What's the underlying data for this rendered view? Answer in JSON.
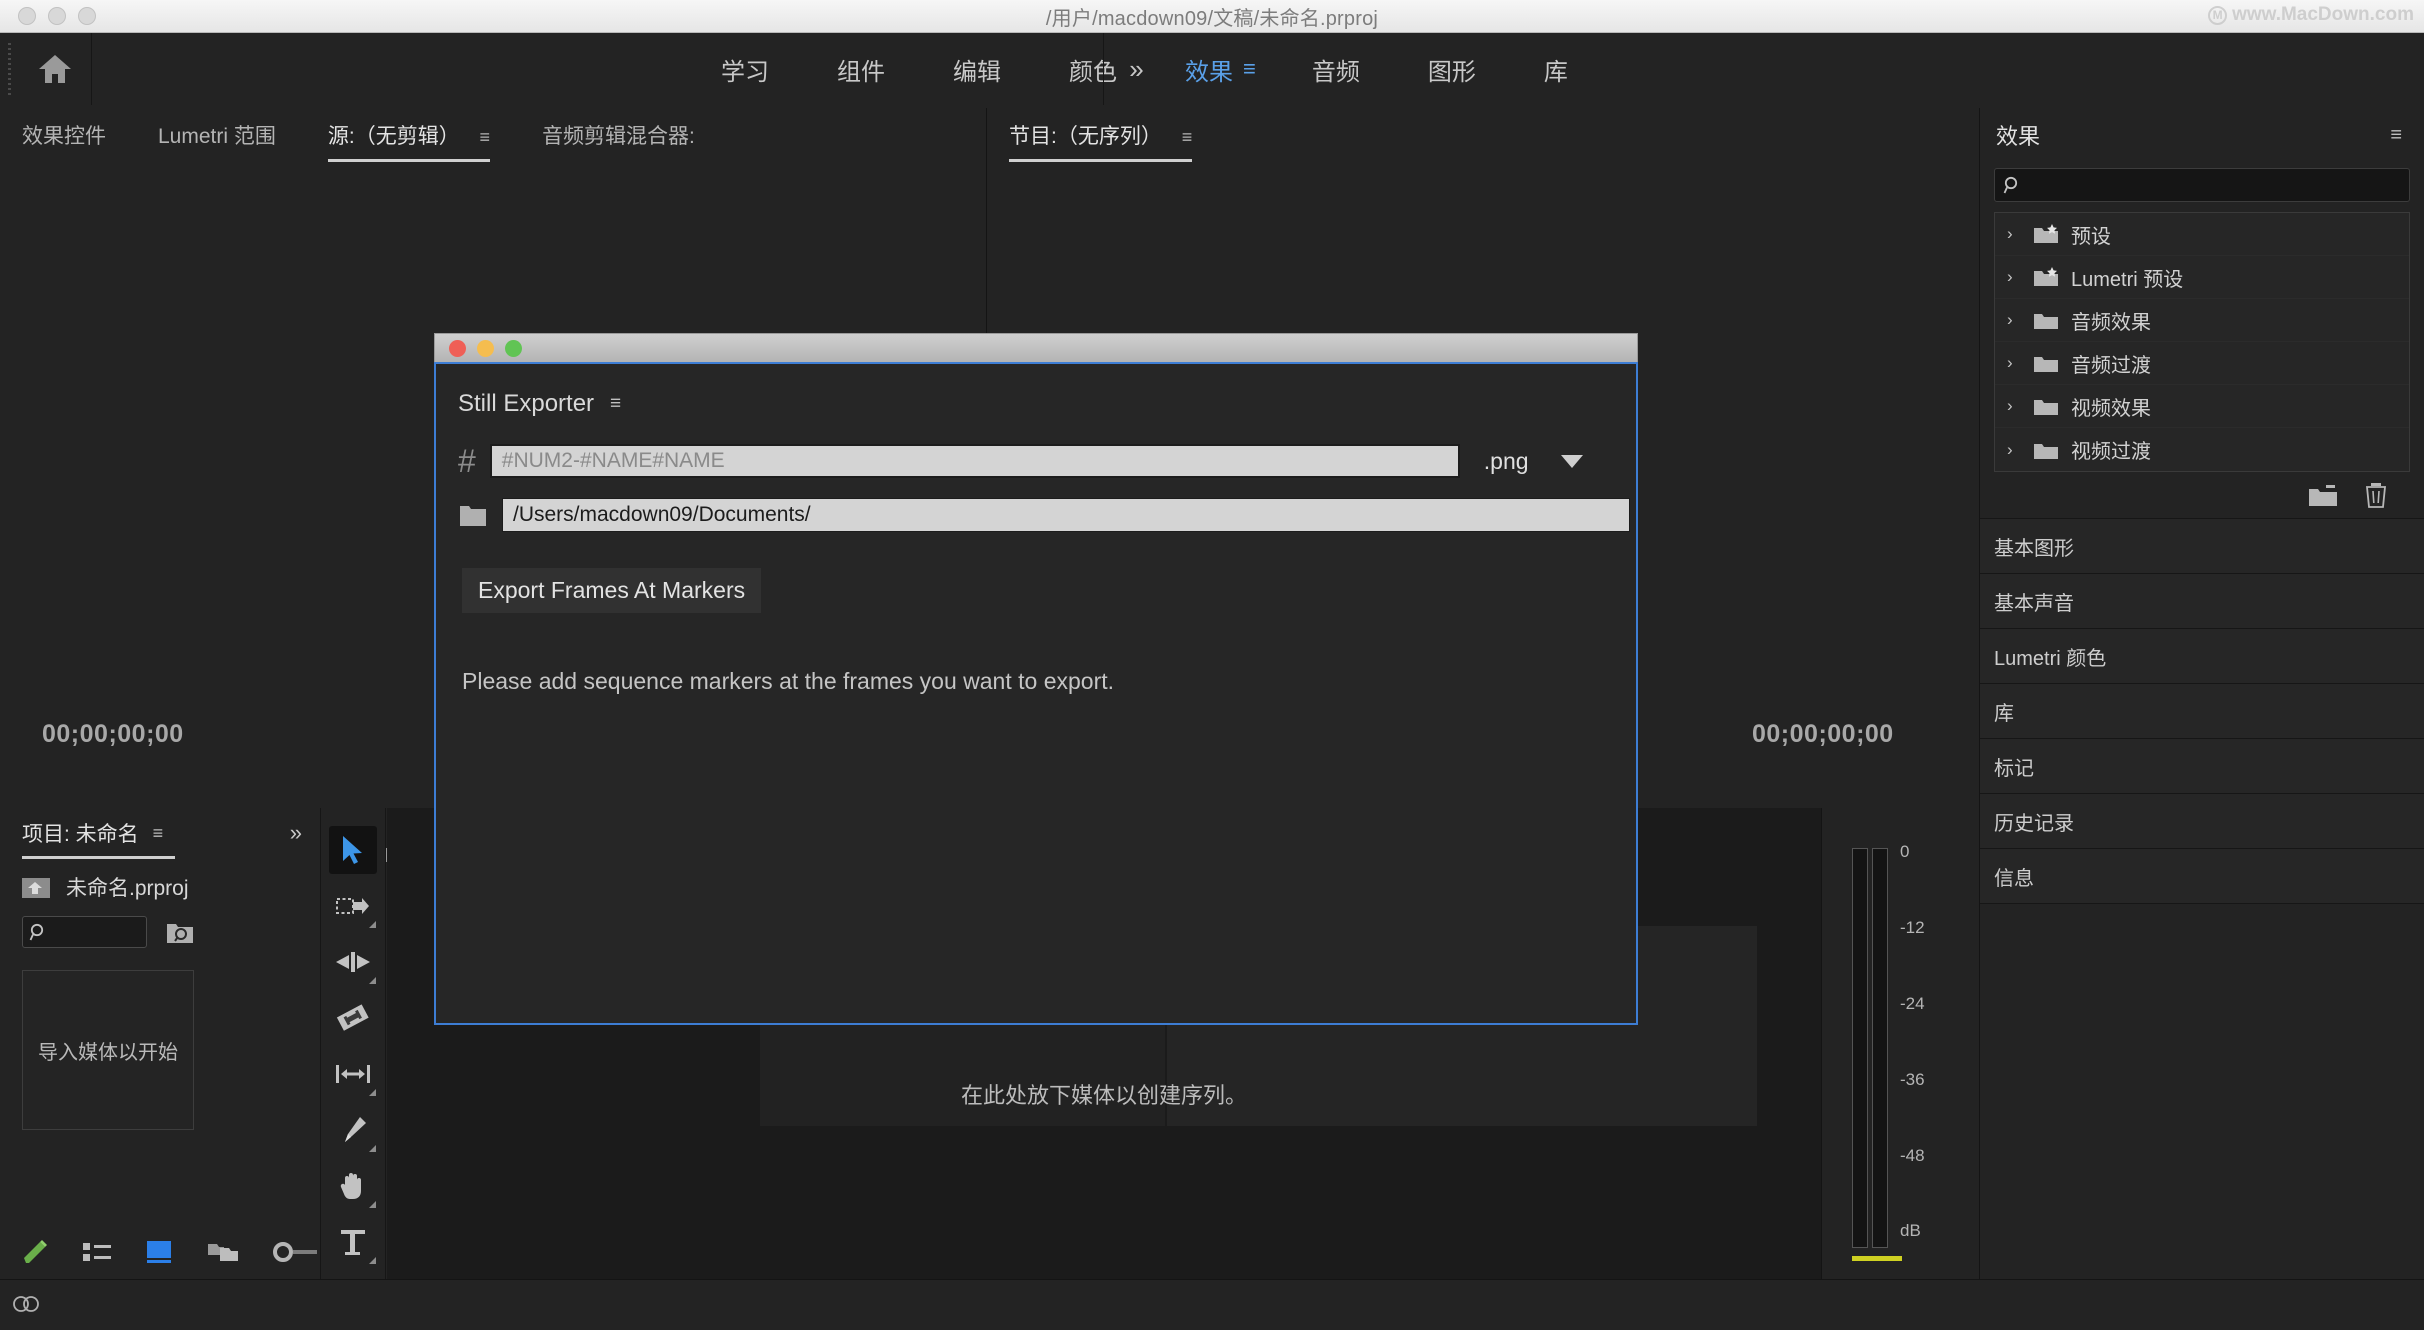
{
  "window": {
    "title": "/用户/macdown09/文稿/未命名.prproj",
    "watermark": "www.MacDown.com"
  },
  "menubar": {
    "home_icon": "home-icon",
    "tabs": [
      {
        "label": "学习",
        "active": false
      },
      {
        "label": "组件",
        "active": false
      },
      {
        "label": "编辑",
        "active": false
      },
      {
        "label": "颜色",
        "active": false
      },
      {
        "label": "效果",
        "active": true
      },
      {
        "label": "音频",
        "active": false
      },
      {
        "label": "图形",
        "active": false
      },
      {
        "label": "库",
        "active": false
      }
    ],
    "overflow": "»"
  },
  "source_panel": {
    "tabs": [
      {
        "label": "效果控件",
        "active": false
      },
      {
        "label": "Lumetri 范围",
        "active": false
      },
      {
        "label": "源:（无剪辑）",
        "active": true
      },
      {
        "label": "音频剪辑混合器:",
        "active": false
      }
    ],
    "timecode": "00;00;00;00"
  },
  "program_panel": {
    "tabs": [
      {
        "label": "节目:（无序列）",
        "active": true
      }
    ],
    "timecode": "00;00;00;00",
    "overflow": "»",
    "add_label": "+"
  },
  "effects_panel": {
    "title": "效果",
    "burger": "≡",
    "search_placeholder": "",
    "search_value": "",
    "tree": [
      {
        "label": "预设",
        "icon": "folder-star-icon",
        "expanded": false
      },
      {
        "label": "Lumetri 预设",
        "icon": "folder-star-icon",
        "expanded": false
      },
      {
        "label": "音频效果",
        "icon": "folder-icon",
        "expanded": false
      },
      {
        "label": "音频过渡",
        "icon": "folder-icon",
        "expanded": false
      },
      {
        "label": "视频效果",
        "icon": "folder-icon",
        "expanded": false
      },
      {
        "label": "视频过渡",
        "icon": "folder-icon",
        "expanded": false
      }
    ],
    "collapsed_panels": [
      "基本图形",
      "基本声音",
      "Lumetri 颜色",
      "库",
      "标记",
      "历史记录",
      "信息"
    ]
  },
  "project_panel": {
    "tab": "项目: 未命名",
    "burger": "≡",
    "overflow": "»",
    "file_name": "未命名.prproj",
    "search_value": "",
    "drop_hint": "导入媒体以开始"
  },
  "timeline_panel": {
    "drop_hint": "在此处放下媒体以创建序列。"
  },
  "audio_meters": {
    "ticks": [
      "0",
      "-12",
      "-24",
      "-36",
      "-48",
      "dB"
    ],
    "unit": "dB"
  },
  "tools": [
    {
      "name": "selection-tool",
      "active": true
    },
    {
      "name": "track-select-forward-tool",
      "active": false
    },
    {
      "name": "ripple-edit-tool",
      "active": false
    },
    {
      "name": "rolling-edit-tool",
      "active": false
    },
    {
      "name": "rate-stretch-tool",
      "active": false
    },
    {
      "name": "pen-tool",
      "active": false
    },
    {
      "name": "hand-tool",
      "active": false
    },
    {
      "name": "type-tool",
      "active": false
    }
  ],
  "dialog": {
    "title": "Still Exporter",
    "burger": "≡",
    "filename_value": "#NUM2-#NAME#NAME",
    "filename_placeholder": "#NUM2-#NAME#NAME",
    "extension": ".png",
    "path_value": "/Users/macdown09/Documents/",
    "export_button": "Export Frames At Markers",
    "message": "Please add sequence markers at the frames you want to export."
  },
  "colors": {
    "accent_blue": "#5aa0e8",
    "dialog_border": "#3d7dd4",
    "panel_bg": "#232323",
    "meter_yellow": "#cfd122"
  }
}
